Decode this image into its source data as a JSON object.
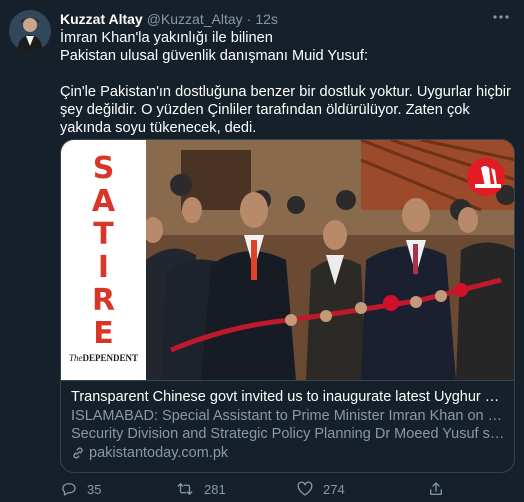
{
  "tweet": {
    "name": "Kuzzat Altay",
    "handle": "@Kuzzat_Altay",
    "separator": "·",
    "time": "12s",
    "lines": [
      "İmran Khan'la yakınlığı ile bilinen",
      "Pakistan ulusal güvenlik danışmanı Muid Yusuf:",
      "Çin'le Pakistan'ın dostluğuna benzer bir dostluk yoktur. Uygurlar hiçbir şey değildir. O yüzden Çinliler tarafından öldürülüyor. Zaten çok yakında soyu tükenecek, dedi."
    ],
    "more_icon": "more-horizontal-icon"
  },
  "card": {
    "satire_label": "SATIRE",
    "source_small": "The",
    "source_brand": "DEPENDENT",
    "title": "Transparent Chinese govt invited us to inaugurate latest Uyghur concentration camp",
    "description_line1": "ISLAMABAD: Special Assistant to Prime Minister Imran Khan on National",
    "description_line2": "Security Division and Strategic Policy Planning Dr Moeed Yusuf silenced the Uyghur critics",
    "domain": "pakistantoday.com.pk",
    "badge_icon": "praying-hands-icon",
    "link_icon": "link-icon"
  },
  "actions": {
    "reply_count": "35",
    "retweet_count": "281",
    "like_count": "274",
    "icons": [
      "reply-icon",
      "retweet-icon",
      "like-icon",
      "share-icon"
    ]
  },
  "colors": {
    "background": "#15202b",
    "border": "#38444d",
    "secondary_text": "#8899a6",
    "satire_red": "#d9362a",
    "badge_red": "#e31b23"
  }
}
